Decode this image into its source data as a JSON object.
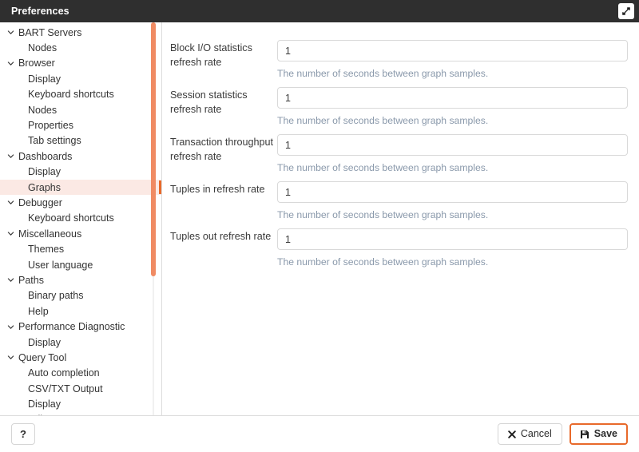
{
  "window": {
    "title": "Preferences",
    "maximize_icon": "maximize-expand-icon"
  },
  "colors": {
    "titlebar_bg": "#2f2f2f",
    "accent_orange": "#e8692a",
    "selected_row_bg": "#fbe9e4",
    "scrollbar_thumb": "#f08b63",
    "help_text": "#8a99ab",
    "input_border": "#d9d9d9"
  },
  "sidebar": {
    "scrollbar": "vertical-scrollbar",
    "items": [
      {
        "label": "BART Servers",
        "level": "group",
        "expanded": true,
        "selected": false
      },
      {
        "label": "Nodes",
        "level": "child",
        "expanded": false,
        "selected": false
      },
      {
        "label": "Browser",
        "level": "group",
        "expanded": true,
        "selected": false
      },
      {
        "label": "Display",
        "level": "child",
        "expanded": false,
        "selected": false
      },
      {
        "label": "Keyboard shortcuts",
        "level": "child",
        "expanded": false,
        "selected": false
      },
      {
        "label": "Nodes",
        "level": "child",
        "expanded": false,
        "selected": false
      },
      {
        "label": "Properties",
        "level": "child",
        "expanded": false,
        "selected": false
      },
      {
        "label": "Tab settings",
        "level": "child",
        "expanded": false,
        "selected": false
      },
      {
        "label": "Dashboards",
        "level": "group",
        "expanded": true,
        "selected": false
      },
      {
        "label": "Display",
        "level": "child",
        "expanded": false,
        "selected": false
      },
      {
        "label": "Graphs",
        "level": "child",
        "expanded": false,
        "selected": true
      },
      {
        "label": "Debugger",
        "level": "group",
        "expanded": true,
        "selected": false
      },
      {
        "label": "Keyboard shortcuts",
        "level": "child",
        "expanded": false,
        "selected": false
      },
      {
        "label": "Miscellaneous",
        "level": "group",
        "expanded": true,
        "selected": false
      },
      {
        "label": "Themes",
        "level": "child",
        "expanded": false,
        "selected": false
      },
      {
        "label": "User language",
        "level": "child",
        "expanded": false,
        "selected": false
      },
      {
        "label": "Paths",
        "level": "group",
        "expanded": true,
        "selected": false
      },
      {
        "label": "Binary paths",
        "level": "child",
        "expanded": false,
        "selected": false
      },
      {
        "label": "Help",
        "level": "child",
        "expanded": false,
        "selected": false
      },
      {
        "label": "Performance Diagnostic",
        "level": "group",
        "expanded": true,
        "selected": false
      },
      {
        "label": "Display",
        "level": "child",
        "expanded": false,
        "selected": false
      },
      {
        "label": "Query Tool",
        "level": "group",
        "expanded": true,
        "selected": false
      },
      {
        "label": "Auto completion",
        "level": "child",
        "expanded": false,
        "selected": false
      },
      {
        "label": "CSV/TXT Output",
        "level": "child",
        "expanded": false,
        "selected": false
      },
      {
        "label": "Display",
        "level": "child",
        "expanded": false,
        "selected": false
      },
      {
        "label": "Editor",
        "level": "child",
        "expanded": false,
        "selected": false
      }
    ]
  },
  "content": {
    "fields": [
      {
        "label": "Block I/O statistics refresh rate",
        "value": "1",
        "placeholder": "",
        "help": "The number of seconds between graph samples."
      },
      {
        "label": "Session statistics refresh rate",
        "value": "1",
        "placeholder": "",
        "help": "The number of seconds between graph samples."
      },
      {
        "label": "Transaction throughput refresh rate",
        "value": "1",
        "placeholder": "",
        "help": "The number of seconds between graph samples."
      },
      {
        "label": "Tuples in refresh rate",
        "value": "1",
        "placeholder": "",
        "help": "The number of seconds between graph samples."
      },
      {
        "label": "Tuples out refresh rate",
        "value": "1",
        "placeholder": "",
        "help": "The number of seconds between graph samples."
      }
    ]
  },
  "footer": {
    "help_label": "?",
    "cancel_label": "Cancel",
    "cancel_icon": "close-x-icon",
    "save_label": "Save",
    "save_icon": "floppy-disk-save-icon"
  }
}
